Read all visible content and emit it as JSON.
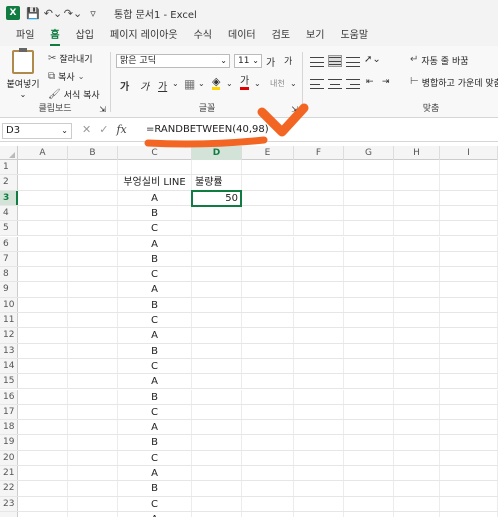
{
  "titlebar": {
    "logo": "X",
    "title": "통합 문서1  -  Excel",
    "icons": [
      "excel-logo",
      "save-icon",
      "undo-icon",
      "redo-icon",
      "customize-icon"
    ]
  },
  "tabs": [
    {
      "label": "파일"
    },
    {
      "label": "홈",
      "active": true
    },
    {
      "label": "삽입"
    },
    {
      "label": "페이지 레이아웃"
    },
    {
      "label": "수식"
    },
    {
      "label": "데이터"
    },
    {
      "label": "검토"
    },
    {
      "label": "보기"
    },
    {
      "label": "도움말"
    }
  ],
  "ribbon": {
    "clipboard": {
      "paste": "붙여넣기",
      "cut": "잘라내기",
      "copy": "복사",
      "format_painter": "서식 복사",
      "label": "클립보드"
    },
    "font": {
      "name": "맑은 고딕",
      "size": "11",
      "grow": "가",
      "shrink": "가",
      "bold": "가",
      "italic": "가",
      "underline": "가",
      "font_color_glyph": "가",
      "phonetic": "내천",
      "label": "글꼴"
    },
    "alignment": {
      "wrap_text": "자동 줄 바꿈",
      "merge_center": "병합하고 가운데 맞춤",
      "label": "맞춤"
    }
  },
  "formula_bar": {
    "name_box": "D3",
    "formula": "=RANDBETWEEN(40,98)",
    "fx": "fx"
  },
  "sheet": {
    "columns": [
      "A",
      "B",
      "C",
      "D",
      "E",
      "F",
      "G",
      "H",
      "I"
    ],
    "active_column": "D",
    "active_row": "3",
    "rows": [
      {
        "num": "1",
        "c": "",
        "d": ""
      },
      {
        "num": "2",
        "c": "부엉실비 LINE",
        "d": "불량률"
      },
      {
        "num": "3",
        "c": "A",
        "d": "50"
      },
      {
        "num": "4",
        "c": "B",
        "d": ""
      },
      {
        "num": "5",
        "c": "C",
        "d": ""
      },
      {
        "num": "6",
        "c": "A",
        "d": ""
      },
      {
        "num": "7",
        "c": "B",
        "d": ""
      },
      {
        "num": "8",
        "c": "C",
        "d": ""
      },
      {
        "num": "9",
        "c": "A",
        "d": ""
      },
      {
        "num": "10",
        "c": "B",
        "d": ""
      },
      {
        "num": "11",
        "c": "C",
        "d": ""
      },
      {
        "num": "12",
        "c": "A",
        "d": ""
      },
      {
        "num": "13",
        "c": "B",
        "d": ""
      },
      {
        "num": "14",
        "c": "C",
        "d": ""
      },
      {
        "num": "15",
        "c": "A",
        "d": ""
      },
      {
        "num": "16",
        "c": "B",
        "d": ""
      },
      {
        "num": "17",
        "c": "C",
        "d": ""
      },
      {
        "num": "18",
        "c": "A",
        "d": ""
      },
      {
        "num": "19",
        "c": "B",
        "d": ""
      },
      {
        "num": "20",
        "c": "C",
        "d": ""
      },
      {
        "num": "21",
        "c": "A",
        "d": ""
      },
      {
        "num": "22",
        "c": "B",
        "d": ""
      },
      {
        "num": "23",
        "c": "C",
        "d": ""
      },
      {
        "num": "",
        "c": "A",
        "d": ""
      }
    ]
  },
  "colors": {
    "accent": "#107c41",
    "annotation": "#f26522"
  }
}
